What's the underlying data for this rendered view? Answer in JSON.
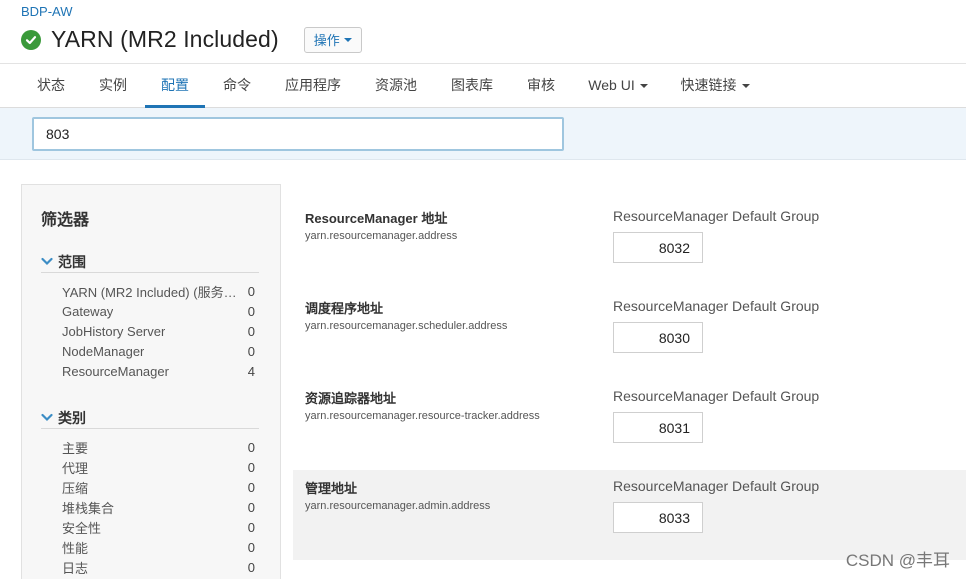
{
  "header": {
    "cluster_name": "BDP-AW",
    "service_title": "YARN (MR2 Included)",
    "actions_label": "操作"
  },
  "tabs": [
    {
      "label": "状态",
      "active": false
    },
    {
      "label": "实例",
      "active": false
    },
    {
      "label": "配置",
      "active": true
    },
    {
      "label": "命令",
      "active": false
    },
    {
      "label": "应用程序",
      "active": false
    },
    {
      "label": "资源池",
      "active": false
    },
    {
      "label": "图表库",
      "active": false
    },
    {
      "label": "审核",
      "active": false
    },
    {
      "label": "Web UI",
      "active": false,
      "dropdown": true
    },
    {
      "label": "快速链接",
      "active": false,
      "dropdown": true
    }
  ],
  "search": {
    "value": "803"
  },
  "filters": {
    "title": "筛选器",
    "scope": {
      "label": "范围",
      "items": [
        {
          "label": "YARN (MR2 Included) (服务…",
          "count": "0"
        },
        {
          "label": "Gateway",
          "count": "0"
        },
        {
          "label": "JobHistory Server",
          "count": "0"
        },
        {
          "label": "NodeManager",
          "count": "0"
        },
        {
          "label": "ResourceManager",
          "count": "4"
        }
      ]
    },
    "category": {
      "label": "类别",
      "items": [
        {
          "label": "主要",
          "count": "0"
        },
        {
          "label": "代理",
          "count": "0"
        },
        {
          "label": "压缩",
          "count": "0"
        },
        {
          "label": "堆栈集合",
          "count": "0"
        },
        {
          "label": "安全性",
          "count": "0"
        },
        {
          "label": "性能",
          "count": "0"
        },
        {
          "label": "日志",
          "count": "0"
        }
      ]
    }
  },
  "results": [
    {
      "name": "ResourceManager 地址",
      "key": "yarn.resourcemanager.address",
      "group": "ResourceManager Default Group",
      "value": "8032"
    },
    {
      "name": "调度程序地址",
      "key": "yarn.resourcemanager.scheduler.address",
      "group": "ResourceManager Default Group",
      "value": "8030"
    },
    {
      "name": "资源追踪器地址",
      "key": "yarn.resourcemanager.resource-tracker.address",
      "group": "ResourceManager Default Group",
      "value": "8031"
    },
    {
      "name": "管理地址",
      "key": "yarn.resourcemanager.admin.address",
      "group": "ResourceManager Default Group",
      "value": "8033"
    }
  ],
  "watermark": "CSDN @丰耳",
  "colors": {
    "accent": "#1f74b5",
    "status_good": "#3a9a3a"
  }
}
